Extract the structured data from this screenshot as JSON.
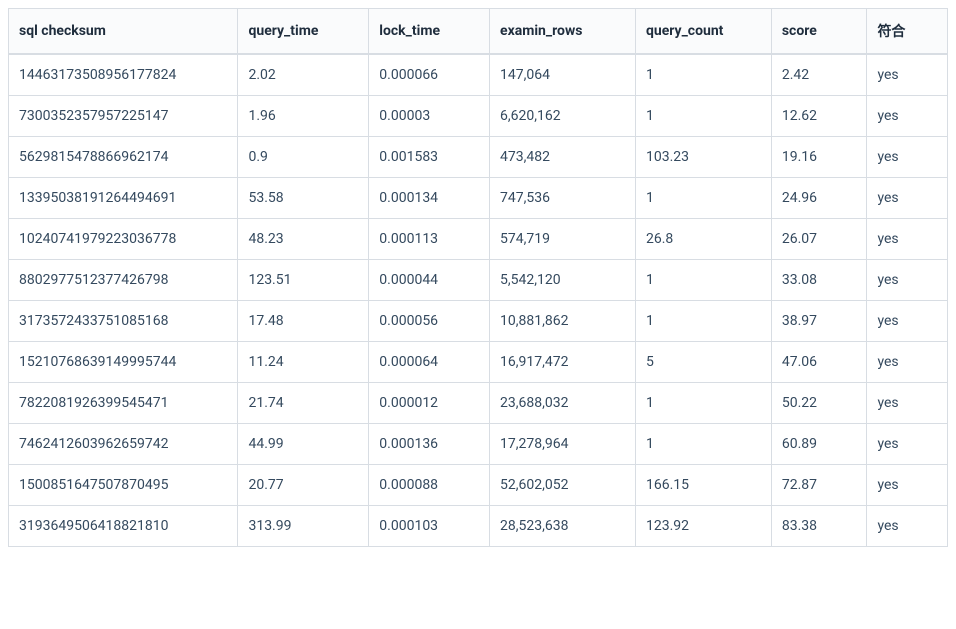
{
  "table": {
    "headers": {
      "checksum": "sql checksum",
      "query_time": "query_time",
      "lock_time": "lock_time",
      "examin_rows": "examin_rows",
      "query_count": "query_count",
      "score": "score",
      "meet": "符合"
    },
    "rows": [
      {
        "checksum": "14463173508956177824",
        "query_time": "2.02",
        "lock_time": "0.000066",
        "examin_rows": "147,064",
        "query_count": "1",
        "score": "2.42",
        "meet": "yes"
      },
      {
        "checksum": "7300352357957225147",
        "query_time": "1.96",
        "lock_time": "0.00003",
        "examin_rows": "6,620,162",
        "query_count": "1",
        "score": "12.62",
        "meet": "yes"
      },
      {
        "checksum": "5629815478866962174",
        "query_time": "0.9",
        "lock_time": "0.001583",
        "examin_rows": "473,482",
        "query_count": "103.23",
        "score": "19.16",
        "meet": "yes"
      },
      {
        "checksum": "13395038191264494691",
        "query_time": "53.58",
        "lock_time": "0.000134",
        "examin_rows": "747,536",
        "query_count": "1",
        "score": "24.96",
        "meet": "yes"
      },
      {
        "checksum": "10240741979223036778",
        "query_time": "48.23",
        "lock_time": "0.000113",
        "examin_rows": "574,719",
        "query_count": "26.8",
        "score": "26.07",
        "meet": "yes"
      },
      {
        "checksum": "8802977512377426798",
        "query_time": "123.51",
        "lock_time": "0.000044",
        "examin_rows": "5,542,120",
        "query_count": "1",
        "score": "33.08",
        "meet": "yes"
      },
      {
        "checksum": "3173572433751085168",
        "query_time": "17.48",
        "lock_time": "0.000056",
        "examin_rows": "10,881,862",
        "query_count": "1",
        "score": "38.97",
        "meet": "yes"
      },
      {
        "checksum": "15210768639149995744",
        "query_time": "11.24",
        "lock_time": "0.000064",
        "examin_rows": "16,917,472",
        "query_count": "5",
        "score": "47.06",
        "meet": "yes"
      },
      {
        "checksum": "7822081926399545471",
        "query_time": "21.74",
        "lock_time": "0.000012",
        "examin_rows": "23,688,032",
        "query_count": "1",
        "score": "50.22",
        "meet": "yes"
      },
      {
        "checksum": "7462412603962659742",
        "query_time": "44.99",
        "lock_time": "0.000136",
        "examin_rows": "17,278,964",
        "query_count": "1",
        "score": "60.89",
        "meet": "yes"
      },
      {
        "checksum": "1500851647507870495",
        "query_time": "20.77",
        "lock_time": "0.000088",
        "examin_rows": "52,602,052",
        "query_count": "166.15",
        "score": "72.87",
        "meet": "yes"
      },
      {
        "checksum": "3193649506418821810",
        "query_time": "313.99",
        "lock_time": "0.000103",
        "examin_rows": "28,523,638",
        "query_count": "123.92",
        "score": "83.38",
        "meet": "yes"
      }
    ]
  }
}
